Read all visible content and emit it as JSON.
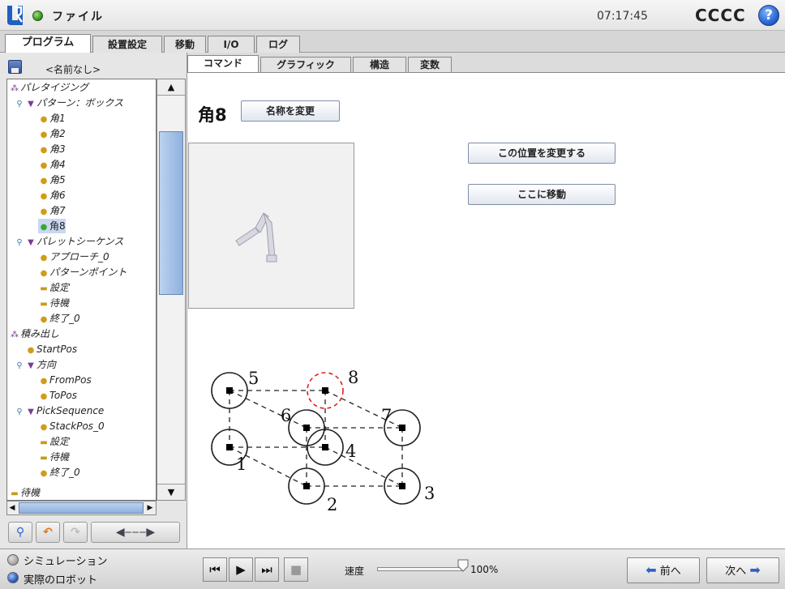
{
  "topbar": {
    "file_menu": "ファイル",
    "time": "07:17:45",
    "robot_name": "CCCC",
    "help": "?"
  },
  "main_tabs": [
    "プログラム",
    "設置設定",
    "移動",
    "I/O",
    "ログ"
  ],
  "program": {
    "name": "<名前なし>"
  },
  "tree": [
    {
      "label": "パレタイジング"
    },
    {
      "label": "パターン：ボックス"
    },
    {
      "label": "角1"
    },
    {
      "label": "角2"
    },
    {
      "label": "角3"
    },
    {
      "label": "角4"
    },
    {
      "label": "角5"
    },
    {
      "label": "角6"
    },
    {
      "label": "角7"
    },
    {
      "label": "角8"
    },
    {
      "label": "パレットシーケンス"
    },
    {
      "label": "アプローチ_0"
    },
    {
      "label": "パターンポイント"
    },
    {
      "label": "設定"
    },
    {
      "label": "待機"
    },
    {
      "label": "終了_0"
    },
    {
      "label": "積み出し"
    },
    {
      "label": "StartPos"
    },
    {
      "label": "方向"
    },
    {
      "label": "FromPos"
    },
    {
      "label": "ToPos"
    },
    {
      "label": "PickSequence"
    },
    {
      "label": "StackPos_0"
    },
    {
      "label": "設定"
    },
    {
      "label": "待機"
    },
    {
      "label": "終了_0"
    },
    {
      "label": "待機"
    }
  ],
  "sub_tabs": [
    "コマンド",
    "グラフィック",
    "構造",
    "変数"
  ],
  "command": {
    "title": "角8",
    "rename_button": "名称を変更",
    "change_position_button": "この位置を変更する",
    "move_here_button": "ここに移動"
  },
  "pattern_labels": [
    "1",
    "2",
    "3",
    "4",
    "5",
    "6",
    "7",
    "8"
  ],
  "bottom": {
    "simulation": "シミュレーション",
    "real_robot": "実際のロボット",
    "speed_label": "速度",
    "speed_value": "100%",
    "speed_fraction": 1.0,
    "prev_button": "前へ",
    "next_button": "次へ"
  },
  "icons": {
    "status": "status-green-icon",
    "help": "help-icon",
    "save": "save-icon",
    "search": "search-icon",
    "undo": "undo-icon",
    "redo": "redo-icon"
  },
  "colors": {
    "selected_corner": "#e02020",
    "scroll_thumb": "#9fbbe2",
    "accent_blue": "#2d63c8"
  }
}
